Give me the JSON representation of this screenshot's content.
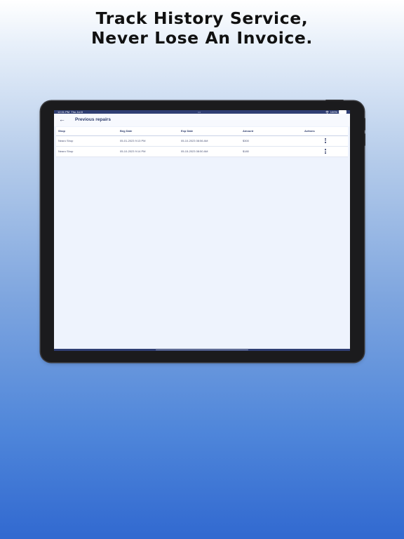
{
  "promo": {
    "line1": "Track History Service,",
    "line2": "Never Lose An Invoice."
  },
  "status_bar": {
    "time": "12:31 PM",
    "date": "Thu Jul 8",
    "dots": "•••",
    "wifi_icon": "wifi-icon",
    "battery_text": "100%",
    "battery_level": 1.0
  },
  "app_bar": {
    "back_icon": "←",
    "title": "Previous repairs"
  },
  "table": {
    "columns": [
      "Shop",
      "Beg Date",
      "Exp Date",
      "Amount",
      "Actions"
    ],
    "rows": [
      [
        "Nearo Shop",
        "05-01-2023 9:13 PM",
        "05-10-2023 08:56 AM",
        "$300"
      ],
      [
        "Nearo Shop",
        "05-10-2023 9:14 PM",
        "05-15-2023 08:50 AM",
        "$180"
      ]
    ],
    "action_icon": "more-vertical-icon"
  }
}
